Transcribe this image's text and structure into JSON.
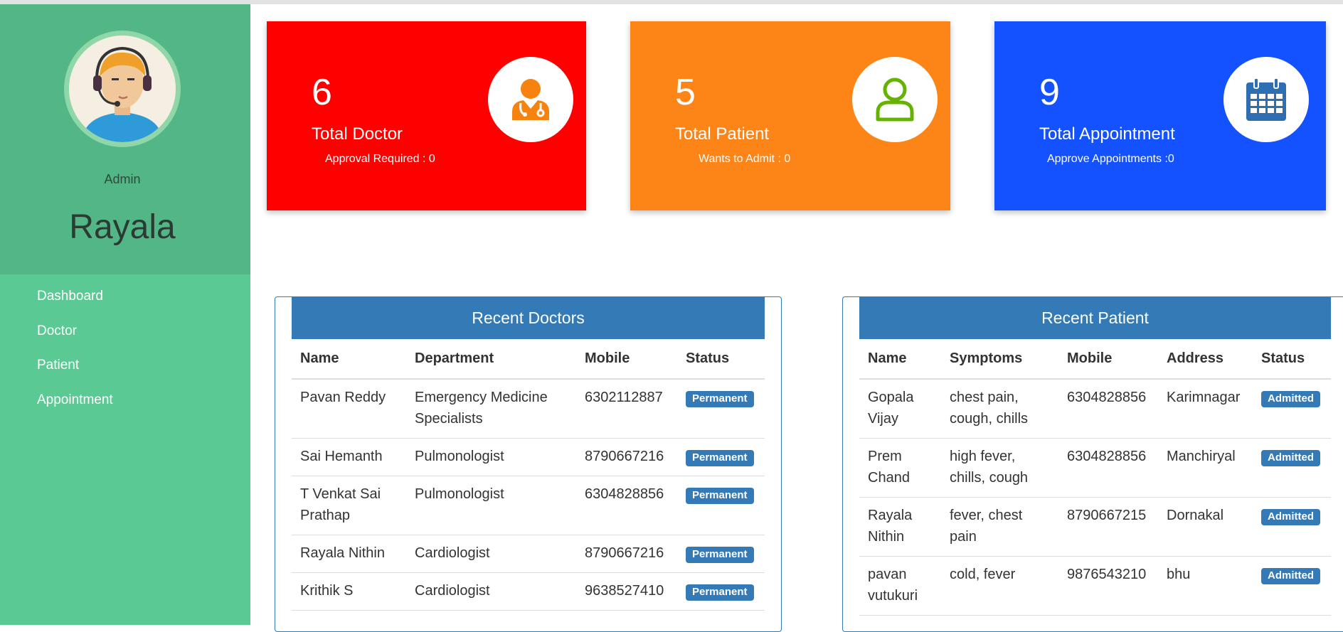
{
  "sidebar": {
    "role": "Admin",
    "user_name": "Rayala",
    "nav": [
      "Dashboard",
      "Doctor",
      "Patient",
      "Appointment"
    ]
  },
  "cards": [
    {
      "count": "6",
      "title": "Total Doctor",
      "sub": "Approval Required : 0",
      "color": "#ff0000",
      "icon": "doctor-icon",
      "icon_color": "#f6830f"
    },
    {
      "count": "5",
      "title": "Total Patient",
      "sub": "Wants to Admit : 0",
      "color": "#fd8416",
      "icon": "patient-icon",
      "icon_color": "#65b300"
    },
    {
      "count": "9",
      "title": "Total Appointment",
      "sub": "Approve Appointments :0",
      "color": "#1552ff",
      "icon": "calendar-icon",
      "icon_color": "#2e6fb4"
    }
  ],
  "doctors": {
    "title": "Recent Doctors",
    "headers": [
      "Name",
      "Department",
      "Mobile",
      "Status"
    ],
    "rows": [
      {
        "name": "Pavan Reddy",
        "department": "Emergency Medicine Specialists",
        "mobile": "6302112887",
        "status": "Permanent"
      },
      {
        "name": "Sai Hemanth",
        "department": "Pulmonologist",
        "mobile": "8790667216",
        "status": "Permanent"
      },
      {
        "name": "T Venkat Sai Prathap",
        "department": "Pulmonologist",
        "mobile": "6304828856",
        "status": "Permanent"
      },
      {
        "name": "Rayala Nithin",
        "department": "Cardiologist",
        "mobile": "8790667216",
        "status": "Permanent"
      },
      {
        "name": "Krithik S",
        "department": "Cardiologist",
        "mobile": "9638527410",
        "status": "Permanent"
      }
    ]
  },
  "patients": {
    "title": "Recent Patient",
    "headers": [
      "Name",
      "Symptoms",
      "Mobile",
      "Address",
      "Status"
    ],
    "rows": [
      {
        "name": "Gopala Vijay",
        "symptoms": "chest pain, cough, chills",
        "mobile": "6304828856",
        "address": "Karimnagar",
        "status": "Admitted"
      },
      {
        "name": "Prem Chand",
        "symptoms": "high fever, chills, cough",
        "mobile": "6304828856",
        "address": "Manchiryal",
        "status": "Admitted"
      },
      {
        "name": "Rayala Nithin",
        "symptoms": "fever, chest pain",
        "mobile": "8790667215",
        "address": "Dornakal",
        "status": "Admitted"
      },
      {
        "name": "pavan vutukuri",
        "symptoms": "cold, fever",
        "mobile": "9876543210",
        "address": "bhu",
        "status": "Admitted"
      }
    ]
  }
}
